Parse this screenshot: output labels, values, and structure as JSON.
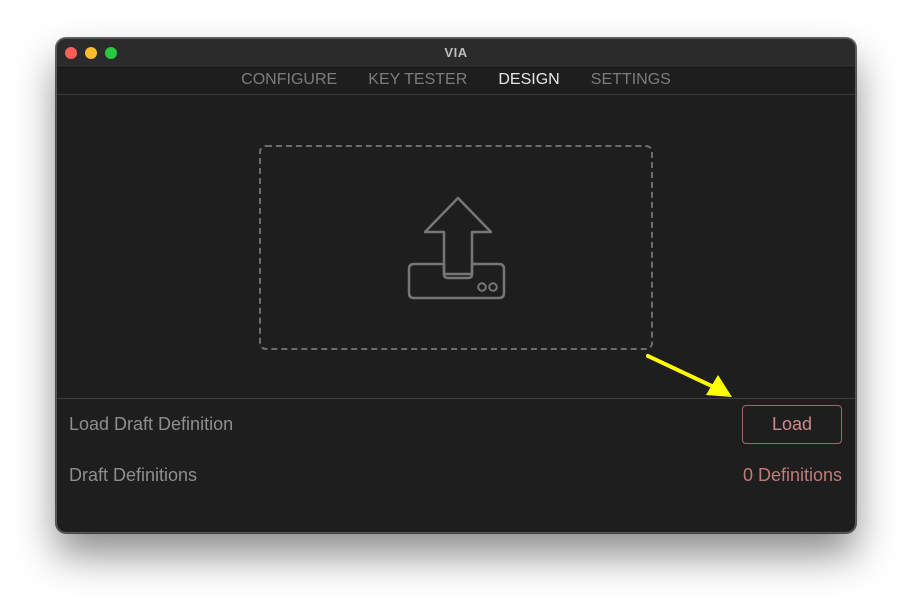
{
  "window": {
    "title": "VIA"
  },
  "menu": {
    "tabs": [
      {
        "label": "CONFIGURE",
        "active": false
      },
      {
        "label": "KEY TESTER",
        "active": false
      },
      {
        "label": "DESIGN",
        "active": true
      },
      {
        "label": "SETTINGS",
        "active": false
      }
    ]
  },
  "dropzone": {
    "icon": "upload-tray-icon"
  },
  "rows": {
    "load_draft_label": "Load Draft Definition",
    "load_button": "Load",
    "draft_definitions_label": "Draft Definitions",
    "definitions_count": "0 Definitions"
  },
  "annotation": {
    "icon": "yellow-arrow-icon",
    "color": "#ffff00"
  },
  "colors": {
    "background": "#1e1e1e",
    "accent": "#d08a8a",
    "tab_active": "#e6e6e6",
    "tab_inactive": "#7c7c7c"
  }
}
